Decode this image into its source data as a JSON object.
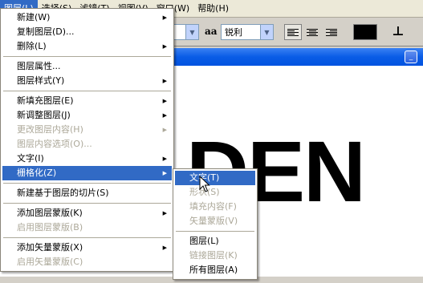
{
  "menubar": {
    "items": [
      {
        "label": "图层(L)"
      },
      {
        "label": "选择(S)"
      },
      {
        "label": "滤镜(T)"
      },
      {
        "label": "视图(V)"
      },
      {
        "label": "窗口(W)"
      },
      {
        "label": "帮助(H)"
      }
    ]
  },
  "options": {
    "antialias_value": "锐利",
    "aa_glyph": "aa",
    "dropdown_arrow": "▼",
    "text_color": "#000000",
    "warp_glyph": "⊥"
  },
  "canvas": {
    "text": "DEN",
    "fore_color": "#000000",
    "background": "#ffffff"
  },
  "main_menu": {
    "groups": [
      [
        {
          "label": "新建(W)",
          "submenu": true,
          "disabled": false
        },
        {
          "label": "复制图层(D)...",
          "submenu": false,
          "disabled": false
        },
        {
          "label": "删除(L)",
          "submenu": true,
          "disabled": false
        }
      ],
      [
        {
          "label": "图层属性...",
          "submenu": false,
          "disabled": false
        },
        {
          "label": "图层样式(Y)",
          "submenu": true,
          "disabled": false
        }
      ],
      [
        {
          "label": "新填充图层(E)",
          "submenu": true,
          "disabled": false
        },
        {
          "label": "新调整图层(J)",
          "submenu": true,
          "disabled": false
        },
        {
          "label": "更改图层内容(H)",
          "submenu": true,
          "disabled": true
        },
        {
          "label": "图层内容选项(O)...",
          "submenu": false,
          "disabled": true
        },
        {
          "label": "文字(I)",
          "submenu": true,
          "disabled": false
        },
        {
          "label": "栅格化(Z)",
          "submenu": true,
          "disabled": false,
          "highlight": true
        }
      ],
      [
        {
          "label": "新建基于图层的切片(S)",
          "submenu": false,
          "disabled": false
        }
      ],
      [
        {
          "label": "添加图层蒙版(K)",
          "submenu": true,
          "disabled": false
        },
        {
          "label": "启用图层蒙版(B)",
          "submenu": false,
          "disabled": true
        }
      ],
      [
        {
          "label": "添加矢量蒙版(X)",
          "submenu": true,
          "disabled": false
        },
        {
          "label": "启用矢量蒙版(C)",
          "submenu": false,
          "disabled": true
        }
      ]
    ]
  },
  "sub_menu": {
    "groups": [
      [
        {
          "label": "文字(T)",
          "disabled": false,
          "highlight": true
        },
        {
          "label": "形状(S)",
          "disabled": true
        },
        {
          "label": "填充内容(F)",
          "disabled": true
        },
        {
          "label": "矢量蒙版(V)",
          "disabled": true
        }
      ],
      [
        {
          "label": "图层(L)",
          "disabled": false
        },
        {
          "label": "链接图层(K)",
          "disabled": true
        },
        {
          "label": "所有图层(A)",
          "disabled": false
        }
      ]
    ]
  },
  "colors": {
    "highlight": "#316ac5",
    "disabled_text": "#aca899",
    "titlebar": "#0a5ce6"
  },
  "icons": {
    "submenu_arrow": "▶",
    "minimize": "_"
  }
}
